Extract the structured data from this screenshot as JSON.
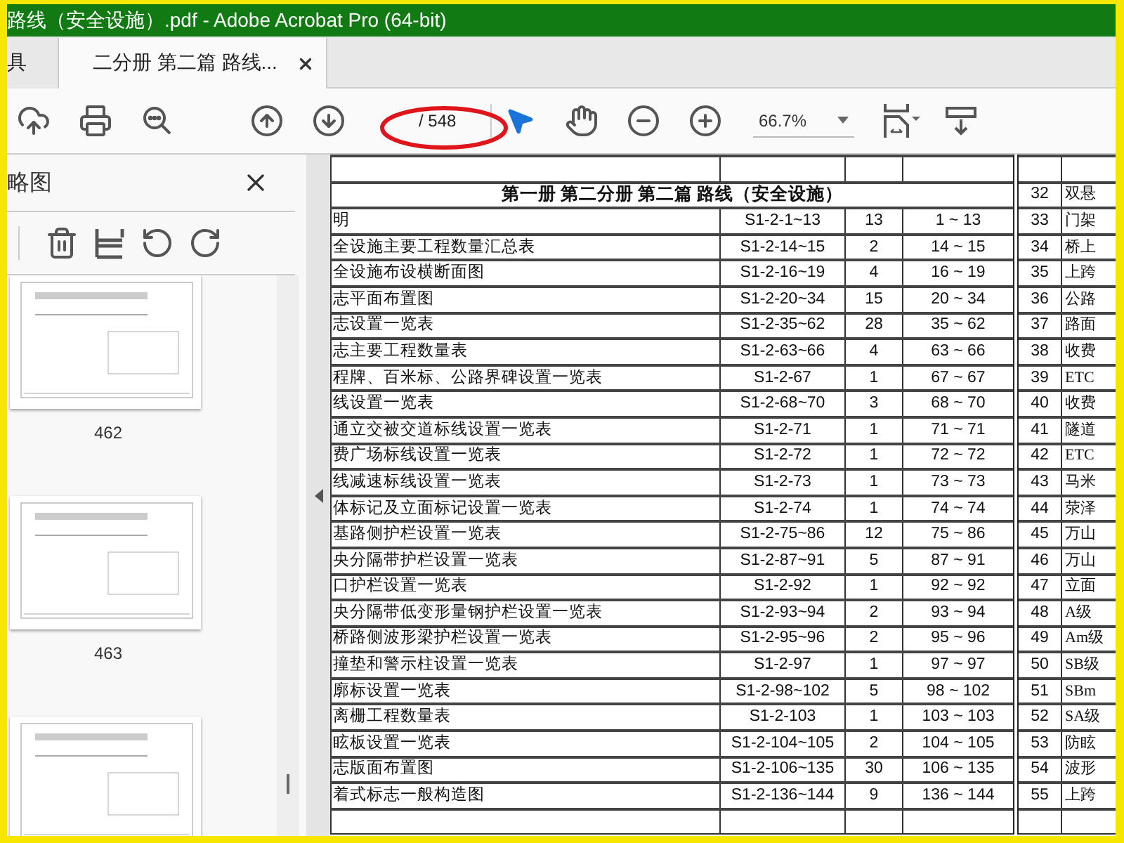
{
  "window": {
    "title": "路线（安全设施）.pdf - Adobe Acrobat Pro (64-bit)"
  },
  "tabs": [
    {
      "label": "具",
      "selected": false
    },
    {
      "label": "二分册 第二篇 路线...",
      "selected": true
    }
  ],
  "toolbar": {
    "page_total": "/ 548",
    "zoom": "66.7%"
  },
  "sidebar": {
    "title": "略图",
    "thumbnails": [
      {
        "kind": "full",
        "label": "462"
      },
      {
        "kind": "full",
        "label": "463"
      },
      {
        "kind": "cut"
      }
    ]
  },
  "document": {
    "heading": "第一册 第二分册 第二篇 路线（安全设施）",
    "heading_no": "32",
    "heading_name": "双悬",
    "rows": [
      {
        "title": "明",
        "code": "S1-2-1~13",
        "count": "13",
        "pages": "1 ~ 13",
        "no": "33",
        "name": "门架"
      },
      {
        "title": "全设施主要工程数量汇总表",
        "code": "S1-2-14~15",
        "count": "2",
        "pages": "14 ~ 15",
        "no": "34",
        "name": "桥上"
      },
      {
        "title": "全设施布设横断面图",
        "code": "S1-2-16~19",
        "count": "4",
        "pages": "16 ~ 19",
        "no": "35",
        "name": "上跨"
      },
      {
        "title": "志平面布置图",
        "code": "S1-2-20~34",
        "count": "15",
        "pages": "20 ~ 34",
        "no": "36",
        "name": "公路"
      },
      {
        "title": "志设置一览表",
        "code": "S1-2-35~62",
        "count": "28",
        "pages": "35 ~ 62",
        "no": "37",
        "name": "路面"
      },
      {
        "title": "志主要工程数量表",
        "code": "S1-2-63~66",
        "count": "4",
        "pages": "63 ~ 66",
        "no": "38",
        "name": "收费"
      },
      {
        "title": "程牌、百米标、公路界碑设置一览表",
        "code": "S1-2-67",
        "count": "1",
        "pages": "67 ~ 67",
        "no": "39",
        "name": "ETC"
      },
      {
        "title": "线设置一览表",
        "code": "S1-2-68~70",
        "count": "3",
        "pages": "68 ~ 70",
        "no": "40",
        "name": "收费"
      },
      {
        "title": "通立交被交道标线设置一览表",
        "code": "S1-2-71",
        "count": "1",
        "pages": "71 ~ 71",
        "no": "41",
        "name": "隧道"
      },
      {
        "title": "费广场标线设置一览表",
        "code": "S1-2-72",
        "count": "1",
        "pages": "72 ~ 72",
        "no": "42",
        "name": "ETC"
      },
      {
        "title": "线减速标线设置一览表",
        "code": "S1-2-73",
        "count": "1",
        "pages": "73 ~ 73",
        "no": "43",
        "name": "马米"
      },
      {
        "title": "体标记及立面标记设置一览表",
        "code": "S1-2-74",
        "count": "1",
        "pages": "74 ~ 74",
        "no": "44",
        "name": "荥泽"
      },
      {
        "title": "基路侧护栏设置一览表",
        "code": "S1-2-75~86",
        "count": "12",
        "pages": "75 ~ 86",
        "no": "45",
        "name": "万山"
      },
      {
        "title": "央分隔带护栏设置一览表",
        "code": "S1-2-87~91",
        "count": "5",
        "pages": "87 ~ 91",
        "no": "46",
        "name": "万山"
      },
      {
        "title": "口护栏设置一览表",
        "code": "S1-2-92",
        "count": "1",
        "pages": "92 ~ 92",
        "no": "47",
        "name": "立面"
      },
      {
        "title": "央分隔带低变形量钢护栏设置一览表",
        "code": "S1-2-93~94",
        "count": "2",
        "pages": "93 ~ 94",
        "no": "48",
        "name": "A级"
      },
      {
        "title": "桥路侧波形梁护栏设置一览表",
        "code": "S1-2-95~96",
        "count": "2",
        "pages": "95 ~ 96",
        "no": "49",
        "name": "Am级"
      },
      {
        "title": "撞垫和警示柱设置一览表",
        "code": "S1-2-97",
        "count": "1",
        "pages": "97 ~ 97",
        "no": "50",
        "name": "SB级"
      },
      {
        "title": "廓标设置一览表",
        "code": "S1-2-98~102",
        "count": "5",
        "pages": "98 ~ 102",
        "no": "51",
        "name": "SBm"
      },
      {
        "title": "离栅工程数量表",
        "code": "S1-2-103",
        "count": "1",
        "pages": "103 ~ 103",
        "no": "52",
        "name": "SA级"
      },
      {
        "title": "眩板设置一览表",
        "code": "S1-2-104~105",
        "count": "2",
        "pages": "104 ~ 105",
        "no": "53",
        "name": "防眩"
      },
      {
        "title": "志版面布置图",
        "code": "S1-2-106~135",
        "count": "30",
        "pages": "106 ~ 135",
        "no": "54",
        "name": "波形"
      },
      {
        "title": "着式标志一般构造图",
        "code": "S1-2-136~144",
        "count": "9",
        "pages": "136 ~ 144",
        "no": "55",
        "name": "上跨"
      }
    ]
  }
}
